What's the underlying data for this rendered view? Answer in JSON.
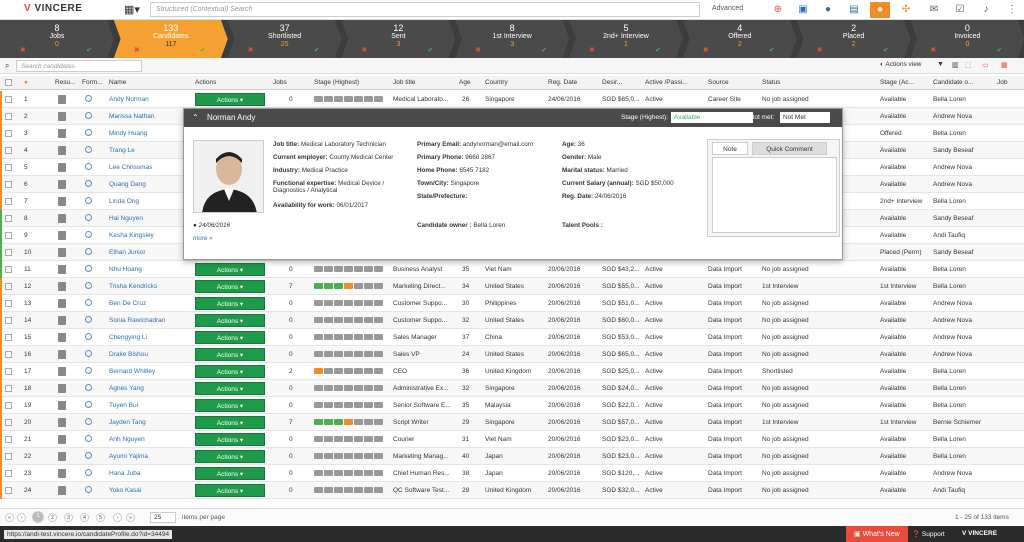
{
  "app": {
    "logo_v": "V",
    "logo_text": "VINCERE",
    "search_placeholder": "Structured (Contextual) Search",
    "advanced": "Advanced"
  },
  "colors": {
    "accent": "#f5a032",
    "actions_green": "#1f9a4b",
    "link": "#2a6fb5"
  },
  "pipeline": [
    {
      "num": "8",
      "label": "Jobs",
      "count": "0"
    },
    {
      "num": "133",
      "label": "Candidates",
      "count": "117"
    },
    {
      "num": "37",
      "label": "Shortlisted",
      "count": "25"
    },
    {
      "num": "12",
      "label": "Sent",
      "count": "3"
    },
    {
      "num": "8",
      "label": "1st Interview",
      "count": "3"
    },
    {
      "num": "5",
      "label": "2nd+ Interview",
      "count": "1"
    },
    {
      "num": "4",
      "label": "Offered",
      "count": "2"
    },
    {
      "num": "2",
      "label": "Placed",
      "count": "2"
    },
    {
      "num": "0",
      "label": "Invoiced",
      "count": "0"
    }
  ],
  "filter": {
    "candidate_search_placeholder": "Search candidates",
    "actions_view": "Actions view"
  },
  "columns": [
    "Resu...",
    "Form...",
    "Name",
    "Actions",
    "Jobs",
    "Stage (Highest)",
    "Job title",
    "Age",
    "Country",
    "Reg. Date",
    "Desir...",
    "Active /Passi...",
    "Source",
    "Status",
    "Stage (Ac...",
    "Candidate o...",
    "Job"
  ],
  "actions_label": "Actions",
  "rows": [
    {
      "n": "1",
      "name": "Andy Norman",
      "jobs": "0",
      "job": "Medical Laborato...",
      "age": "26",
      "country": "Singapore",
      "reg": "24/06/2016",
      "sal": "SGD $65,0...",
      "ap": "Active",
      "src": "Career Site",
      "status": "No job assigned",
      "stage": "Available",
      "owner": "Bella Loren"
    },
    {
      "n": "2",
      "name": "Marissa Nathan",
      "stage": "Available",
      "owner": "Andrew Nova"
    },
    {
      "n": "3",
      "name": "Mindy Huang",
      "stage": "Offered",
      "owner": "Bella Loren"
    },
    {
      "n": "4",
      "name": "Trang Le",
      "stage": "Available",
      "owner": "Sandy Beseaf"
    },
    {
      "n": "5",
      "name": "Lee Chrissmas",
      "stage": "Available",
      "owner": "Andrew Nova"
    },
    {
      "n": "6",
      "name": "Quang Dang",
      "stage": "Available",
      "owner": "Andrew Nova"
    },
    {
      "n": "7",
      "name": "Linda Ong",
      "stage": "2nd+ Interview",
      "owner": "Bella Loren"
    },
    {
      "n": "8",
      "name": "Hai Nguyen",
      "stage": "Available",
      "owner": "Sandy Beseaf"
    },
    {
      "n": "9",
      "name": "Kesha Kingsley",
      "stage": "Available",
      "owner": "Andi Taufiq"
    },
    {
      "n": "10",
      "name": "Ethan Junior",
      "stage": "Placed (Perm)",
      "owner": "Sandy Beseaf"
    },
    {
      "n": "11",
      "name": "Nhu Hoang",
      "jobs": "0",
      "job": "Business Analyst",
      "age": "35",
      "country": "Viet Nam",
      "reg": "20/06/2016",
      "sal": "SGD $43,2...",
      "ap": "Active",
      "src": "Data Import",
      "status": "No job assigned",
      "stage": "Available",
      "owner": "Bella Loren"
    },
    {
      "n": "12",
      "name": "Trisha Kendricks",
      "jobs": "7",
      "job": "Marketing Direct...",
      "age": "34",
      "country": "United States",
      "reg": "20/06/2016",
      "sal": "SGD $55,0...",
      "ap": "Active",
      "src": "Data Import",
      "status": "1st Interview",
      "stage": "1st Interview",
      "owner": "Bella Loren"
    },
    {
      "n": "13",
      "name": "Ben De Cruz",
      "jobs": "0",
      "job": "Customer Suppo...",
      "age": "30",
      "country": "Philippines",
      "reg": "20/06/2016",
      "sal": "SGD $51,0...",
      "ap": "Active",
      "src": "Data Import",
      "status": "No job assigned",
      "stage": "Available",
      "owner": "Andrew Nova"
    },
    {
      "n": "14",
      "name": "Sonia Rawichadran",
      "jobs": "0",
      "job": "Customer Suppo...",
      "age": "32",
      "country": "United States",
      "reg": "20/06/2016",
      "sal": "SGD $60,0...",
      "ap": "Active",
      "src": "Data Import",
      "status": "No job assigned",
      "stage": "Available",
      "owner": "Andrew Nova"
    },
    {
      "n": "15",
      "name": "Chengying Li",
      "jobs": "0",
      "job": "Sales Manager",
      "age": "37",
      "country": "China",
      "reg": "20/06/2016",
      "sal": "SGD $53,0...",
      "ap": "Active",
      "src": "Data Import",
      "status": "No job assigned",
      "stage": "Available",
      "owner": "Andrew Nova"
    },
    {
      "n": "16",
      "name": "Drake Bishou",
      "jobs": "0",
      "job": "Sales VP",
      "age": "24",
      "country": "United States",
      "reg": "20/06/2016",
      "sal": "SGD $65,0...",
      "ap": "Active",
      "src": "Data Import",
      "status": "No job assigned",
      "stage": "Available",
      "owner": "Andrew Nova"
    },
    {
      "n": "17",
      "name": "Bernard Whitley",
      "jobs": "2",
      "job": "CEO",
      "age": "36",
      "country": "United Kingdom",
      "reg": "20/06/2016",
      "sal": "SGD $25,0...",
      "ap": "Active",
      "src": "Data Import",
      "status": "Shortlisted",
      "stage": "Available",
      "owner": "Bella Loren"
    },
    {
      "n": "18",
      "name": "Agnes Yang",
      "jobs": "0",
      "job": "Administrative Ex...",
      "age": "32",
      "country": "Singapore",
      "reg": "20/06/2016",
      "sal": "SGD $24,0...",
      "ap": "Active",
      "src": "Data Import",
      "status": "No job assigned",
      "stage": "Available",
      "owner": "Bella Loren"
    },
    {
      "n": "19",
      "name": "Tuyen Bui",
      "jobs": "0",
      "job": "Senior Software E...",
      "age": "35",
      "country": "Malaysia",
      "reg": "20/06/2016",
      "sal": "SGD $22,0...",
      "ap": "Active",
      "src": "Data Import",
      "status": "No job assigned",
      "stage": "Available",
      "owner": "Bella Loren"
    },
    {
      "n": "20",
      "name": "Jayden Tang",
      "jobs": "7",
      "job": "Script Writer",
      "age": "29",
      "country": "Singapore",
      "reg": "20/06/2016",
      "sal": "SGD $57,0...",
      "ap": "Active",
      "src": "Data Import",
      "status": "1st Interview",
      "stage": "1st Interview",
      "owner": "Bernie Schiemer"
    },
    {
      "n": "21",
      "name": "Anh Nguyen",
      "jobs": "0",
      "job": "Courier",
      "age": "31",
      "country": "Viet Nam",
      "reg": "20/06/2016",
      "sal": "SGD $23,0...",
      "ap": "Active",
      "src": "Data Import",
      "status": "No job assigned",
      "stage": "Available",
      "owner": "Bella Loren"
    },
    {
      "n": "22",
      "name": "Ayumi Yajima",
      "jobs": "0",
      "job": "Marketing Manag...",
      "age": "40",
      "country": "Japan",
      "reg": "20/06/2016",
      "sal": "SGD $23,0...",
      "ap": "Active",
      "src": "Data Import",
      "status": "No job assigned",
      "stage": "Available",
      "owner": "Bella Loren"
    },
    {
      "n": "23",
      "name": "Hana Juba",
      "jobs": "0",
      "job": "Chief Human Res...",
      "age": "38",
      "country": "Japan",
      "reg": "20/06/2016",
      "sal": "SGD $120,...",
      "ap": "Active",
      "src": "Data Import",
      "status": "No job assigned",
      "stage": "Available",
      "owner": "Andrew Nova"
    },
    {
      "n": "24",
      "name": "Yoko Kasai",
      "jobs": "0",
      "job": "QC Software Test...",
      "age": "29",
      "country": "United Kingdom",
      "reg": "20/06/2016",
      "sal": "SGD $32,0...",
      "ap": "Active",
      "src": "Data Import",
      "status": "No job assigned",
      "stage": "Available",
      "owner": "Andi Taufiq"
    }
  ],
  "popup": {
    "name": "Norman Andy",
    "stage_label": "Stage (Highest):",
    "stage_value": "Available",
    "met_label": "Met/Not met:",
    "met_value": "Not Met",
    "job_title_l": "Job title:",
    "job_title": "Medical Laboratory Technician",
    "employer_l": "Current employer:",
    "employer": "County Medical Center",
    "industry_l": "Industry:",
    "industry": "Medical Practice",
    "expertise_l": "Functional expertise:",
    "expertise": "Medical Device / Diagnostics / Analytical",
    "avail_l": "Availability for work:",
    "avail": "06/01/2017",
    "email_l": "Primary Email:",
    "email": "andynorman@email.com",
    "phone_l": "Primary Phone:",
    "phone": "9660 2867",
    "home_l": "Home Phone:",
    "home": "6545 7182",
    "town_l": "Town/City:",
    "town": "Singapore",
    "state_l": "State/Prefecture:",
    "age_l": "Age:",
    "age": "36",
    "gender_l": "Gender:",
    "gender": "Male",
    "marital_l": "Marital status:",
    "marital": "Married",
    "salary_l": "Current Salary (annual):",
    "salary": "SGD $50,000",
    "reg_l": "Reg. Date:",
    "reg": "24/06/2016",
    "date": "24/06/2016",
    "more": "more »",
    "owner_l": "Candidate owner :",
    "owner": "Bella Loren",
    "talent_l": "Talent Pools :",
    "tab_note": "Note",
    "tab_quick": "Quick Comment"
  },
  "pager": {
    "pages": [
      "1",
      "2",
      "3",
      "4",
      "5"
    ],
    "per_page": "25",
    "per_page_label": "items per page",
    "range": "1 - 25 of 133 items"
  },
  "statusbar": {
    "url": "https://andi-test.vincere.io/candidateProfile.do?id=34494",
    "whats_new": "What's New",
    "support": "Support",
    "brand": "VINCERE"
  }
}
